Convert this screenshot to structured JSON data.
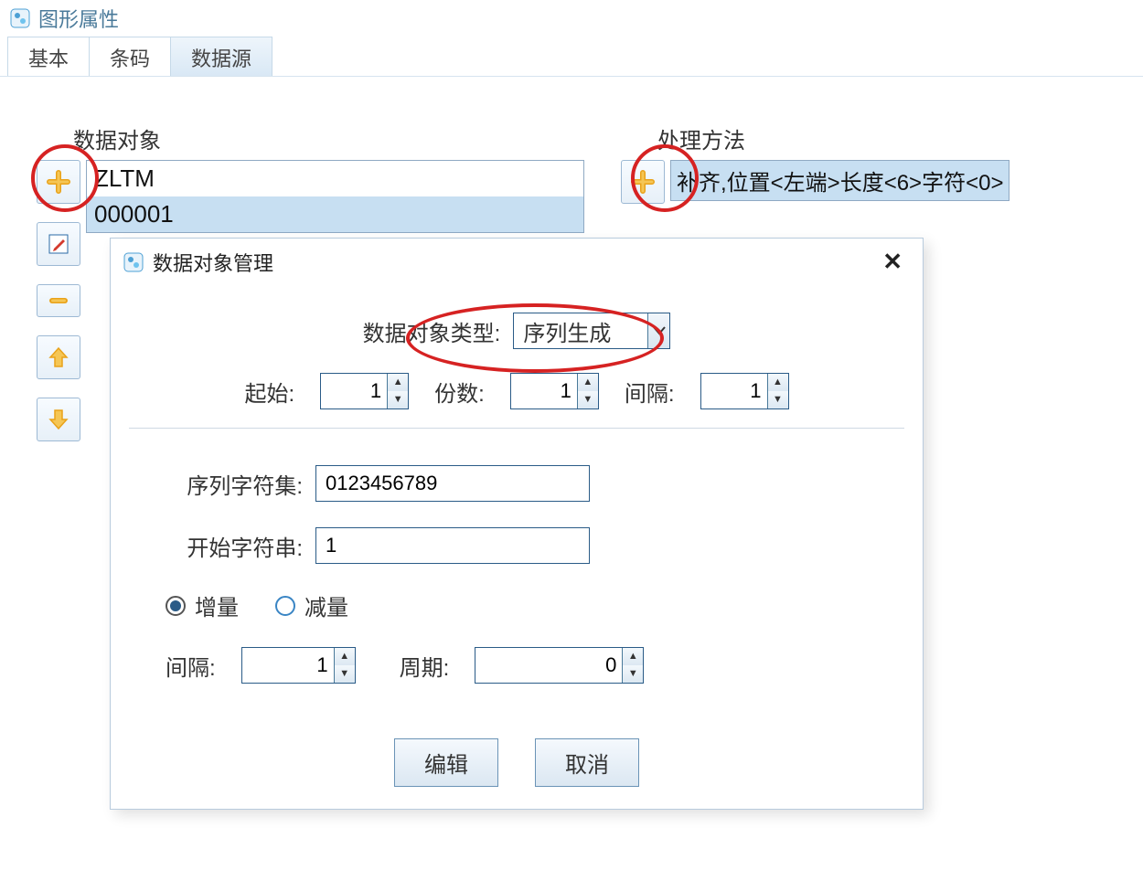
{
  "window": {
    "title": "图形属性"
  },
  "tabs": {
    "basic": "基本",
    "barcode": "条码",
    "datasource": "数据源"
  },
  "data_object": {
    "group_label": "数据对象",
    "items": [
      "ZLTM",
      "000001"
    ]
  },
  "processing": {
    "group_label": "处理方法",
    "items": [
      "补齐,位置<左端>长度<6>字符<0>"
    ]
  },
  "modal": {
    "title": "数据对象管理",
    "type_label": "数据对象类型:",
    "type_value": "序列生成",
    "start_label": "起始:",
    "start_value": "1",
    "copies_label": "份数:",
    "copies_value": "1",
    "interval1_label": "间隔:",
    "interval1_value": "1",
    "charset_label": "序列字符集:",
    "charset_value": "0123456789",
    "startstr_label": "开始字符串:",
    "startstr_value": "1",
    "inc_label": "增量",
    "dec_label": "减量",
    "interval2_label": "间隔:",
    "interval2_value": "1",
    "cycle_label": "周期:",
    "cycle_value": "0",
    "edit_btn": "编辑",
    "cancel_btn": "取消"
  }
}
